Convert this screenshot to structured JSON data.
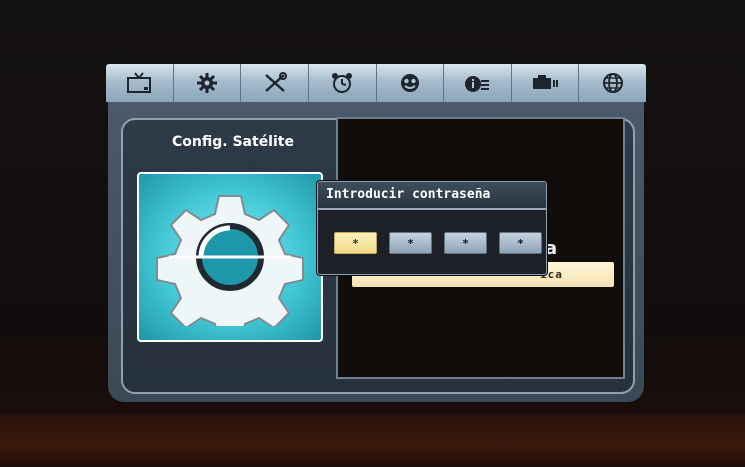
{
  "menu": {
    "tabs": [
      {
        "icon": "tv-icon",
        "label": ""
      },
      {
        "icon": "gear-icon",
        "label": ""
      },
      {
        "icon": "tools-icon",
        "label": ""
      },
      {
        "icon": "alarm-clock-icon",
        "label": ""
      },
      {
        "icon": "face-icon",
        "label": ""
      },
      {
        "icon": "info-icon",
        "label": ""
      },
      {
        "icon": "recording-icon",
        "label": ""
      },
      {
        "icon": "globe-icon",
        "label": ""
      }
    ]
  },
  "left_panel": {
    "title": "Config. Satélite"
  },
  "right_panel": {
    "partial_text": "a",
    "field_partial": "ica"
  },
  "dialog": {
    "title": "Introducir contraseña",
    "slots": [
      "*",
      "*",
      "*",
      "*"
    ],
    "active_index": 0
  },
  "colors": {
    "menubar": "#a7bdcc",
    "panel": "#3b4957",
    "gear_bg": "#43c7d4",
    "active_slot": "#f0d98a"
  }
}
